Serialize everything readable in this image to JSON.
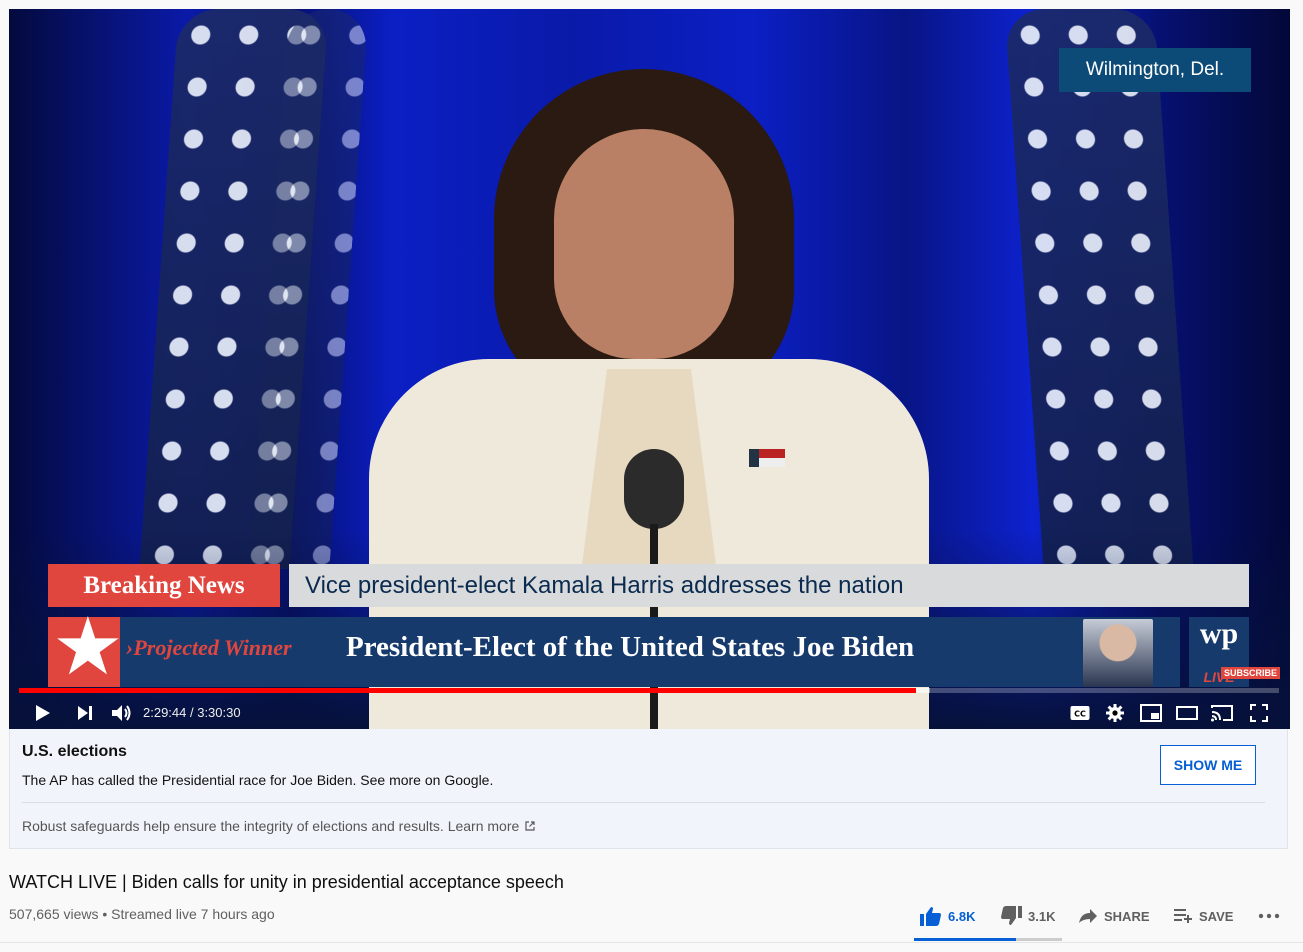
{
  "player": {
    "overlay_location": "Wilmington, Del.",
    "breaking_label": "Breaking News",
    "breaking_text": "Vice president-elect Kamala Harris addresses the nation",
    "ticker_prefix": "›Projected Winner",
    "ticker_main": "President-Elect of the United States  Joe Biden",
    "wp_logo": "wp",
    "wp_live": "LIVE",
    "subscribe_badge": "SUBSCRIBE",
    "time_display": "2:29:44 / 3:30:30",
    "progress_fraction": 0.7118,
    "buffer_fraction": 0.7227,
    "controls": [
      "play-icon",
      "next-icon",
      "volume-icon",
      "captions-icon",
      "settings-icon",
      "miniplayer-icon",
      "theater-icon",
      "cast-icon",
      "fullscreen-icon"
    ],
    "cc_label": "CC"
  },
  "info_panel": {
    "title": "U.S. elections",
    "description": "The AP has called the Presidential race for Joe Biden. See more on Google.",
    "button": "SHOW ME",
    "footer": "Robust safeguards help ensure the integrity of elections and results.",
    "footer_link": "Learn more"
  },
  "video": {
    "title": "WATCH LIVE | Biden calls for unity in presidential acceptance speech",
    "stats": "507,665 views • Streamed live 7 hours ago",
    "likes": "6.8K",
    "dislikes": "3.1K",
    "share": "SHARE",
    "save": "SAVE",
    "like_ratio": 0.6868
  },
  "colors": {
    "accent_blue": "#065fd4",
    "breaking_red": "#e0463e",
    "ticker_blue": "#173a6c",
    "progress_red": "#ff0000"
  }
}
